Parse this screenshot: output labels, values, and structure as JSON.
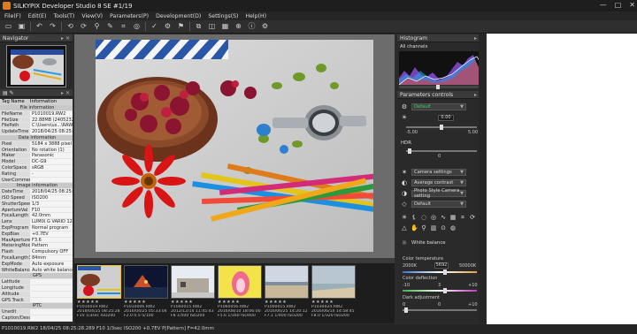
{
  "app": {
    "title": "SILKYPIX Developer Studio 8 SE  #1/19",
    "window_controls": [
      "—",
      "□",
      "✕"
    ]
  },
  "menu": [
    "File(F)",
    "Edit(E)",
    "Tools(T)",
    "View(V)",
    "Parameters(P)",
    "Development(D)",
    "Settings(S)",
    "Help(H)"
  ],
  "toolbar_icons": [
    "open-folder-icon",
    "save-icon",
    "undo-icon",
    "redo-icon",
    "rotate-left-icon",
    "rotate-right-icon",
    "eyedropper-icon",
    "brush-icon",
    "crop-icon",
    "spot-icon",
    "rating-icon",
    "develop-icon",
    "batch-icon",
    "compare-icon",
    "fullscreen-icon",
    "grid-icon",
    "zoom-icon",
    "info-icon",
    "settings-icon"
  ],
  "navigator": {
    "title": "Navigator"
  },
  "info_table": {
    "header": [
      "Tag Name",
      "Information"
    ],
    "rows": [
      {
        "group": "File information"
      },
      {
        "k": "FileName",
        "v": "P1010019.RW2"
      },
      {
        "k": "FileSize",
        "v": "22.88MB (24052328"
      },
      {
        "k": "FilePath",
        "v": "C:\\Users\\us...\\RAW"
      },
      {
        "k": "UpdateTime",
        "v": "2018/04/25 08:25:28"
      },
      {
        "group": "Data information"
      },
      {
        "k": "Pixel",
        "v": "5184 x 3888 pixel"
      },
      {
        "k": "Orientation",
        "v": "No rotation (1)"
      },
      {
        "k": "Maker",
        "v": "Panasonic"
      },
      {
        "k": "Model",
        "v": "DC-G9"
      },
      {
        "k": "ColorSpace",
        "v": "sRGB"
      },
      {
        "k": "Rating",
        "v": "-"
      },
      {
        "k": "UserComment",
        "v": ""
      },
      {
        "group": "Image information"
      },
      {
        "k": "DateTime",
        "v": "2018/04/25 08:25:28"
      },
      {
        "k": "ISO Speed",
        "v": "ISO200"
      },
      {
        "k": "ShutterSpeed",
        "v": "1/3"
      },
      {
        "k": "ApertureVal",
        "v": "F10"
      },
      {
        "k": "FocalLength",
        "v": "42.0mm"
      },
      {
        "k": "Lens",
        "v": "LUMIX G VARIO 12-"
      },
      {
        "k": "ExpProgram",
        "v": "Normal program"
      },
      {
        "k": "ExpBias",
        "v": "+0.7EV"
      },
      {
        "k": "MaxAperture",
        "v": "F3.6"
      },
      {
        "k": "MeteringMode",
        "v": "Pattern"
      },
      {
        "k": "Flash",
        "v": "Compulsory OFF"
      },
      {
        "k": "FocalLength35",
        "v": "84mm"
      },
      {
        "k": "ExpMode",
        "v": "Auto exposure"
      },
      {
        "k": "WhiteBalance",
        "v": "Auto white balance"
      },
      {
        "group": "GPS"
      },
      {
        "k": "Latitude",
        "v": ""
      },
      {
        "k": "Longitude",
        "v": ""
      },
      {
        "k": "Altitude",
        "v": ""
      },
      {
        "k": "GPS Track",
        "v": ""
      },
      {
        "group": "IPTC"
      },
      {
        "k": "Unedit",
        "v": ""
      },
      {
        "k": "Caption/Descri",
        "v": ""
      }
    ]
  },
  "histogram": {
    "title": "Histogram",
    "channel": "All channels"
  },
  "params": {
    "title": "Parameters controls",
    "taste": "Default",
    "exposure_val": "0.00",
    "exposure_min": "-5.00",
    "exposure_max": "5.00",
    "hdr_label": "HDR",
    "hdr_val": "0",
    "camera_settings": "Camera settings",
    "average_contrast": "Average contrast",
    "photo_style": "Photo Style Camera setting",
    "sharp_default": "Default",
    "wb_label": "White balance",
    "color_temp_label": "Color temperature",
    "color_temp_min": "2000K",
    "color_temp_val": "5692",
    "color_temp_max": "50000K",
    "color_deflection_label": "Color deflection",
    "cd_min": "-10",
    "cd_val": "3",
    "cd_max": "+10",
    "dark_adj_label": "Dark adjustment",
    "da_min": "0",
    "da_val": "0",
    "da_max": "+10"
  },
  "filmstrip": [
    {
      "name": "P1010019.RW2",
      "date": "2018/04/25 08:25:28",
      "exp": "F10 1/3sec ISO200",
      "stars": "★ ★ ★ ★ ★"
    },
    {
      "name": "P1010006.RW2",
      "date": "2016/04/25 05:33:04",
      "exp": "F2.0 0.5-5/100",
      "stars": "★ ★ ★ ★ ★"
    },
    {
      "name": "P1040015.RW2",
      "date": "2012/12/14 11:45:43",
      "exp": "F8 1/500 ISO200",
      "stars": "★ ★ ★ ★ ★"
    },
    {
      "name": "P1060056.RW2",
      "date": "2016/08/10 18:06:00",
      "exp": "F5.6 1/160 ISO400",
      "stars": "★ ★ ★ ★ ★"
    },
    {
      "name": "P1000015.RW2",
      "date": "2016/06/25 14:20:12",
      "exp": "F7.1 1/400 ISO200",
      "stars": "★ ★ ★ ★ ★"
    },
    {
      "name": "P1030024.RW2",
      "date": "2016/06/14 14:58:45",
      "exp": "F8.0 1/320 ISO200",
      "stars": "★ ★ ★ ★ ★"
    }
  ],
  "status": "P1010019.RW2 18/04/25 08:25:28.289 F10 1/3sec ISO200 +0.7EV P[Pattern] F=42.0mm",
  "colors": {
    "accent": "#3a8fd6",
    "selected_thumb": "#e8c22a"
  }
}
